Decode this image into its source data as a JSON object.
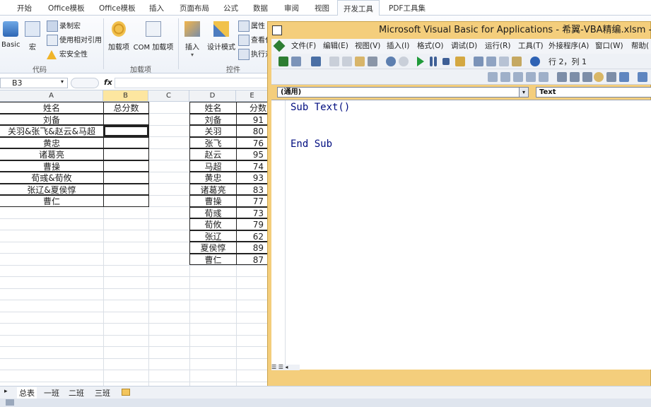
{
  "ribbon_tabs": [
    "开始",
    "Office模板",
    "Office模板",
    "插入",
    "页面布局",
    "公式",
    "数据",
    "审阅",
    "视图",
    "开发工具",
    "PDF工具集"
  ],
  "ribbon": {
    "code": {
      "basic": "Basic",
      "macro": "宏",
      "record": "录制宏",
      "relative": "使用相对引用",
      "security": "宏安全性",
      "group": "代码"
    },
    "addins": {
      "addins": "加载项",
      "com": "COM 加载项",
      "group": "加载项"
    },
    "controls": {
      "insert": "插入",
      "design": "设计模式",
      "props": "属性",
      "view": "查看代",
      "run": "执行对",
      "group": "控件"
    }
  },
  "formula_bar": {
    "name_box": "B3",
    "fx": "fx",
    "value": ""
  },
  "columns_left": [
    "A",
    "B",
    "C",
    "D",
    "E"
  ],
  "table1": {
    "header": [
      "姓名",
      "总分数"
    ],
    "rows": [
      "刘备",
      "关羽&张飞&赵云&马超",
      "黄忠",
      "诸葛亮",
      "曹操",
      "荀彧&荀攸",
      "张辽&夏侯惇",
      "曹仁"
    ]
  },
  "table2": {
    "header": [
      "姓名",
      "分数"
    ],
    "rows": [
      [
        "刘备",
        "91"
      ],
      [
        "关羽",
        "80"
      ],
      [
        "张飞",
        "76"
      ],
      [
        "赵云",
        "95"
      ],
      [
        "马超",
        "74"
      ],
      [
        "黄忠",
        "93"
      ],
      [
        "诸葛亮",
        "83"
      ],
      [
        "曹操",
        "77"
      ],
      [
        "荀彧",
        "73"
      ],
      [
        "荀攸",
        "79"
      ],
      [
        "张辽",
        "62"
      ],
      [
        "夏侯惇",
        "89"
      ],
      [
        "曹仁",
        "87"
      ]
    ]
  },
  "vba": {
    "title": "Microsoft Visual Basic for Applications - 希翼-VBA精编.xlsm - [模块",
    "menu": [
      "文件(F)",
      "编辑(E)",
      "视图(V)",
      "插入(I)",
      "格式(O)",
      "调试(D)",
      "运行(R)",
      "工具(T)",
      "外接程序(A)",
      "窗口(W)",
      "帮助("
    ],
    "cursor_pos": "行 2，列 1",
    "object_combo": "(通用)",
    "proc_combo": "Text",
    "code_lines": [
      "Sub Text()",
      "",
      "End Sub"
    ]
  },
  "sheet_tabs": [
    "总表",
    "一班",
    "二班",
    "三班"
  ],
  "colors": {
    "accent": "#f4ce7c",
    "tab_active_border": "#c6d1df",
    "code_text": "#000d80",
    "selected_col": "#fde6a0"
  }
}
